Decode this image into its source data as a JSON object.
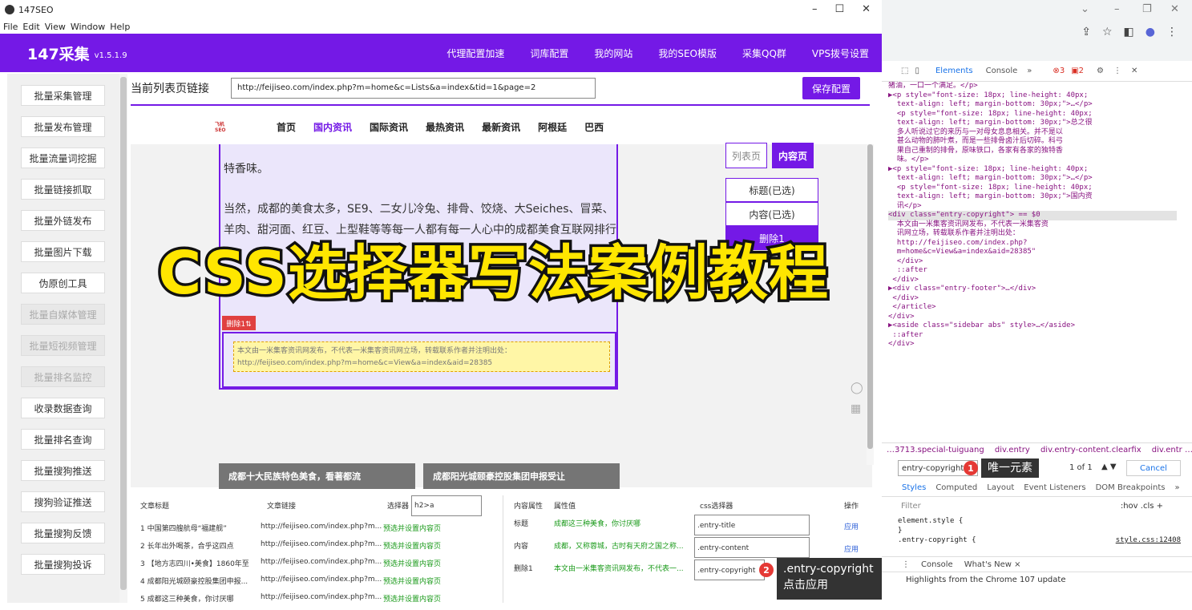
{
  "window": {
    "title": "147SEO",
    "minimize": "–",
    "maximize": "☐",
    "close": "✕"
  },
  "menubar": [
    "File",
    "Edit",
    "View",
    "Window",
    "Help"
  ],
  "header": {
    "brand": "147采集",
    "version": "v1.5.1.9",
    "nav": [
      "代理配置加速",
      "词库配置",
      "我的网站",
      "我的SEO模版",
      "采集QQ群",
      "VPS拨号设置"
    ]
  },
  "sidebar": [
    {
      "label": "批量采集管理",
      "disabled": false
    },
    {
      "label": "批量发布管理",
      "disabled": false
    },
    {
      "label": "批量流量词挖掘",
      "disabled": false
    },
    {
      "label": "批量链接抓取",
      "disabled": false
    },
    {
      "label": "批量外链发布",
      "disabled": false
    },
    {
      "label": "批量图片下载",
      "disabled": false
    },
    {
      "label": "伪原创工具",
      "disabled": false
    },
    {
      "label": "批量自媒体管理",
      "disabled": true
    },
    {
      "label": "批量短视频管理",
      "disabled": true
    },
    {
      "label": "批量排名监控",
      "disabled": true
    },
    {
      "label": "收录数据查询",
      "disabled": false
    },
    {
      "label": "批量排名查询",
      "disabled": false
    },
    {
      "label": "批量搜狗推送",
      "disabled": false
    },
    {
      "label": "搜狗验证推送",
      "disabled": false
    },
    {
      "label": "批量搜狗反馈",
      "disabled": false
    },
    {
      "label": "批量搜狗投诉",
      "disabled": false
    }
  ],
  "urlrow": {
    "label": "当前列表页链接",
    "value": "http://feijiseo.com/index.php?m=home&c=Lists&a=index&tid=1&page=2",
    "save": "保存配置"
  },
  "site": {
    "logo": "飞机SEO",
    "nav": [
      "首页",
      "国内资讯",
      "国际资讯",
      "最热资讯",
      "最新资讯",
      "阿根廷",
      "巴西"
    ],
    "active": 1
  },
  "article": {
    "p1_tail": "特香味。",
    "p2": "当然，成都的美食太多，SE9、二女儿冷兔、排骨、饺烧、大Seiches、冒菜、羊肉、甜河面、红豆、上型鞋等等每一人都有每一人心中的成都美食互联网排行",
    "del_tag": "删除1⇅",
    "copyright": "本文由一米集客资讯网发布，不代表一米集客资讯网立场，转载联系作者并注明出处：http://feijiseo.com/index.php?m=home&c=View&a=index&aid=28385"
  },
  "right_panel": {
    "tabs": [
      "列表页",
      "内容页"
    ],
    "items": [
      "标题(已选)",
      "内容(已选)",
      "删除1"
    ]
  },
  "cards": [
    "成都十大民族特色美食，看著都流",
    "成都阳光城颐豪控股集团申报受让"
  ],
  "overlay_title": "CSS选择器写法案例教程",
  "bottom_left": {
    "headers": {
      "title": "文章标题",
      "link": "文章链接",
      "selector": "选择器"
    },
    "selector_value": "h2>a",
    "rows": [
      {
        "title": "1 中国第四艘航母“福建舰”",
        "link": "http://feijiseo.com/index.php?m...",
        "action": "预选并设置内容页"
      },
      {
        "title": "2 长年出外喝茶，合乎这四点",
        "link": "http://feijiseo.com/index.php?m...",
        "action": "预选并设置内容页"
      },
      {
        "title": "3 【地方志四川•美食】1860年至",
        "link": "http://feijiseo.com/index.php?m...",
        "action": "预选并设置内容页"
      },
      {
        "title": "4 成都阳光城颐豪控股集团申报...",
        "link": "http://feijiseo.com/index.php?m...",
        "action": "预选并设置内容页"
      },
      {
        "title": "5 成都这三种美食，你讨厌哪",
        "link": "http://feijiseo.com/index.php?m...",
        "action": "预选并设置内容页"
      }
    ]
  },
  "bottom_right": {
    "headers": {
      "attr": "内容属性",
      "value": "属性值",
      "css": "css选择器",
      "op": "操作"
    },
    "rows": [
      {
        "attr": "标题",
        "value": "成都这三种美食，你讨厌哪",
        "css": ".entry-title",
        "op": "应用"
      },
      {
        "attr": "内容",
        "value": "成都，又称蓉城，古时有天府之国之称...",
        "css": ".entry-content",
        "op": "应用"
      },
      {
        "attr": "删除1",
        "value": "本文由一米集客资讯网发布，不代表一...",
        "css": ".entry-copyright",
        "op": "应用"
      }
    ],
    "tooltip": {
      "line1": ".entry-copyright",
      "line2": "点击应用",
      "badge": "2"
    }
  },
  "devtools": {
    "tabs": [
      "Elements",
      "Console",
      "»"
    ],
    "errors": "3",
    "warnings": "2",
    "code": [
      "猪油，一口一个满足。</p>",
      "▶<p style=\"font-size: 18px; line-height: 40px;",
      "  text-align: left; margin-bottom: 30px;\">…</p>",
      "  <p style=\"font-size: 18px; line-height: 40px;",
      "  text-align: left; margin-bottom: 30px;\">总之很",
      "  多人听说过它的来历与一对母女息息相关。并不是以",
      "  甚么动物的肺叶煮，而是一些排骨卤汁后切碎。科弓",
      "  果自己重制的排骨，原味铁口，各家有各家的独特香",
      "  味。</p>",
      "▶<p style=\"font-size: 18px; line-height: 40px;",
      "  text-align: left; margin-bottom: 30px;\">…</p>",
      "  <p style=\"font-size: 18px; line-height: 40px;",
      "  text-align: left; margin-bottom: 30px;\">国内资",
      "  讯</p>",
      "<div class=\"entry-copyright\"> == $0",
      "  本文由一米集客资讯网发布，不代表一米集客资",
      "  讯网立场，转载联系作者并注明出处：",
      "  http://feijiseo.com/index.php?",
      "  m=home&c=View&a=index&aid=28385\"",
      "",
      "  </div>",
      "  ::after",
      " </div>",
      "▶<div class=\"entry-footer\">…</div>",
      " </div>",
      " </article>",
      "</div>",
      "▶<aside class=\"sidebar abs\" style>…</aside>",
      " ::after",
      "</div>"
    ],
    "crumbs": [
      "…3713.special-tuiguang",
      "div.entry",
      "div.entry-content.clearfix",
      "div.entr …"
    ],
    "search": {
      "value": "entry-copyright",
      "badge": "1",
      "tooltip": "唯一元素",
      "count": "1 of 1",
      "cancel": "Cancel"
    },
    "style_tabs": [
      "Styles",
      "Computed",
      "Layout",
      "Event Listeners",
      "DOM Breakpoints",
      "»"
    ],
    "filter": "Filter",
    "filter_right": ":hov  .cls  +",
    "styles": [
      "element.style {",
      "}",
      ".entry-copyright {"
    ],
    "style_src": "style.css:12408",
    "console_tabs": [
      "Console",
      "What's New ×"
    ],
    "note": "Highlights from the Chrome 107 update"
  }
}
